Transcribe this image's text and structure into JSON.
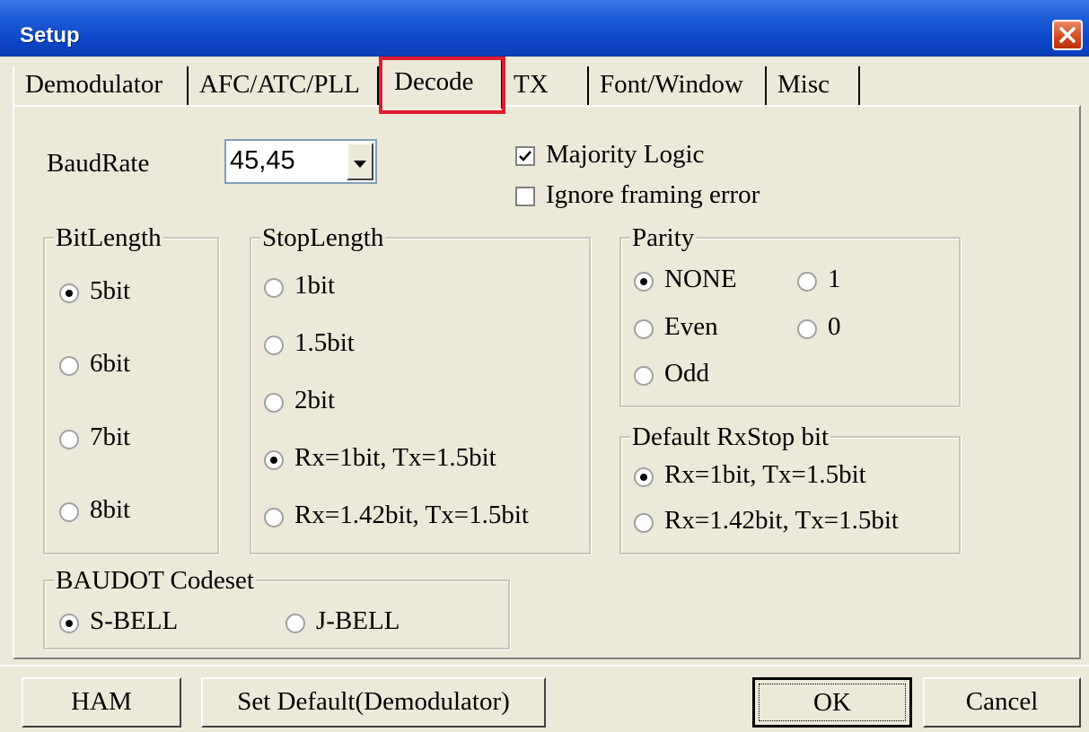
{
  "window": {
    "title": "Setup"
  },
  "tabs": [
    {
      "label": "Demodulator"
    },
    {
      "label": "AFC/ATC/PLL"
    },
    {
      "label": "Decode",
      "active": true
    },
    {
      "label": "TX"
    },
    {
      "label": "Font/Window"
    },
    {
      "label": "Misc"
    }
  ],
  "baudrate": {
    "label": "BaudRate",
    "value": "45,45"
  },
  "checkboxes": [
    {
      "label": "Majority Logic",
      "checked": true
    },
    {
      "label": "Ignore framing error",
      "checked": false
    }
  ],
  "bitlength": {
    "legend": "BitLength",
    "options": [
      {
        "label": "5bit",
        "selected": true
      },
      {
        "label": "6bit",
        "selected": false
      },
      {
        "label": "7bit",
        "selected": false
      },
      {
        "label": "8bit",
        "selected": false
      }
    ]
  },
  "stoplength": {
    "legend": "StopLength",
    "options": [
      {
        "label": "1bit",
        "selected": false
      },
      {
        "label": "1.5bit",
        "selected": false
      },
      {
        "label": "2bit",
        "selected": false
      },
      {
        "label": "Rx=1bit, Tx=1.5bit",
        "selected": true
      },
      {
        "label": "Rx=1.42bit, Tx=1.5bit",
        "selected": false
      }
    ]
  },
  "parity": {
    "legend": "Parity",
    "options": [
      {
        "label": "NONE",
        "selected": true
      },
      {
        "label": "Even",
        "selected": false
      },
      {
        "label": "Odd",
        "selected": false
      },
      {
        "label": "1",
        "selected": false
      },
      {
        "label": "0",
        "selected": false
      }
    ]
  },
  "rxstop": {
    "legend": "Default RxStop bit",
    "options": [
      {
        "label": "Rx=1bit, Tx=1.5bit",
        "selected": true
      },
      {
        "label": "Rx=1.42bit, Tx=1.5bit",
        "selected": false
      }
    ]
  },
  "codeset": {
    "legend": "BAUDOT Codeset",
    "options": [
      {
        "label": "S-BELL",
        "selected": true
      },
      {
        "label": "J-BELL",
        "selected": false
      }
    ]
  },
  "buttons": {
    "ham": "HAM",
    "set_default": "Set Default(Demodulator)",
    "ok": "OK",
    "cancel": "Cancel"
  },
  "colors": {
    "titlebar": "#0d47c8",
    "dialog_bg": "#ece9d8",
    "highlight": "#e21c2c"
  }
}
